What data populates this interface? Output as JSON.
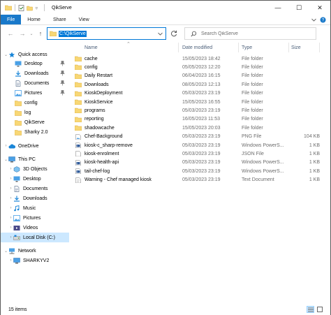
{
  "window": {
    "title": "QikServe",
    "controls": {
      "minimize": "—",
      "maximize": "☐",
      "close": "✕"
    }
  },
  "ribbon": {
    "tabs": [
      "File",
      "Home",
      "Share",
      "View"
    ]
  },
  "address": {
    "path": "C:\\QikServe"
  },
  "search": {
    "placeholder": "Search QikServe"
  },
  "nav": {
    "quick_access": "Quick access",
    "pinned": [
      "Desktop",
      "Downloads",
      "Documents",
      "Pictures"
    ],
    "recent": [
      "config",
      "log",
      "QikServe",
      "Sharky 2.0"
    ],
    "onedrive": "OneDrive",
    "this_pc": "This PC",
    "pc_items": [
      "3D Objects",
      "Desktop",
      "Documents",
      "Downloads",
      "Music",
      "Pictures",
      "Videos",
      "Local Disk (C:)"
    ],
    "network": "Network",
    "network_items": [
      "SHARKYV2"
    ]
  },
  "columns": {
    "name": "Name",
    "date": "Date modified",
    "type": "Type",
    "size": "Size"
  },
  "files": [
    {
      "name": "cache",
      "date": "15/05/2023 18:42",
      "type": "File folder",
      "size": "",
      "icon": "folder-icon"
    },
    {
      "name": "config",
      "date": "05/05/2023 12:20",
      "type": "File folder",
      "size": "",
      "icon": "folder-icon"
    },
    {
      "name": "Daily Restart",
      "date": "06/04/2023 16:15",
      "type": "File folder",
      "size": "",
      "icon": "folder-icon"
    },
    {
      "name": "Downloads",
      "date": "08/05/2023 12:13",
      "type": "File folder",
      "size": "",
      "icon": "folder-icon"
    },
    {
      "name": "KioskDeployment",
      "date": "05/03/2023 23:19",
      "type": "File folder",
      "size": "",
      "icon": "folder-icon"
    },
    {
      "name": "KioskService",
      "date": "15/05/2023 16:55",
      "type": "File folder",
      "size": "",
      "icon": "folder-icon"
    },
    {
      "name": "programs",
      "date": "05/03/2023 23:19",
      "type": "File folder",
      "size": "",
      "icon": "folder-icon"
    },
    {
      "name": "reporting",
      "date": "16/05/2023 11:53",
      "type": "File folder",
      "size": "",
      "icon": "folder-icon"
    },
    {
      "name": "shadowcache",
      "date": "15/05/2023 20:03",
      "type": "File folder",
      "size": "",
      "icon": "folder-icon"
    },
    {
      "name": "Chef-Background",
      "date": "05/03/2023 23:19",
      "type": "PNG File",
      "size": "104 KB",
      "icon": "image-file-icon"
    },
    {
      "name": "kiosk-c_sharp-remove",
      "date": "05/03/2023 23:19",
      "type": "Windows PowerS...",
      "size": "1 KB",
      "icon": "powershell-file-icon"
    },
    {
      "name": "kiosk-enrolment",
      "date": "05/03/2023 23:19",
      "type": "JSON File",
      "size": "1 KB",
      "icon": "json-file-icon"
    },
    {
      "name": "kiosk-health-api",
      "date": "05/03/2023 23:19",
      "type": "Windows PowerS...",
      "size": "1 KB",
      "icon": "powershell-file-icon"
    },
    {
      "name": "tail-chef-log",
      "date": "05/03/2023 23:19",
      "type": "Windows PowerS...",
      "size": "1 KB",
      "icon": "powershell-file-icon"
    },
    {
      "name": "Warning - Chef managed kiosk",
      "date": "05/03/2023 23:19",
      "type": "Text Document",
      "size": "1 KB",
      "icon": "text-file-icon"
    }
  ],
  "status": {
    "count": "15 items"
  },
  "colors": {
    "accent": "#1979ca",
    "folder": "#f8d775",
    "selection": "#cce8ff"
  }
}
